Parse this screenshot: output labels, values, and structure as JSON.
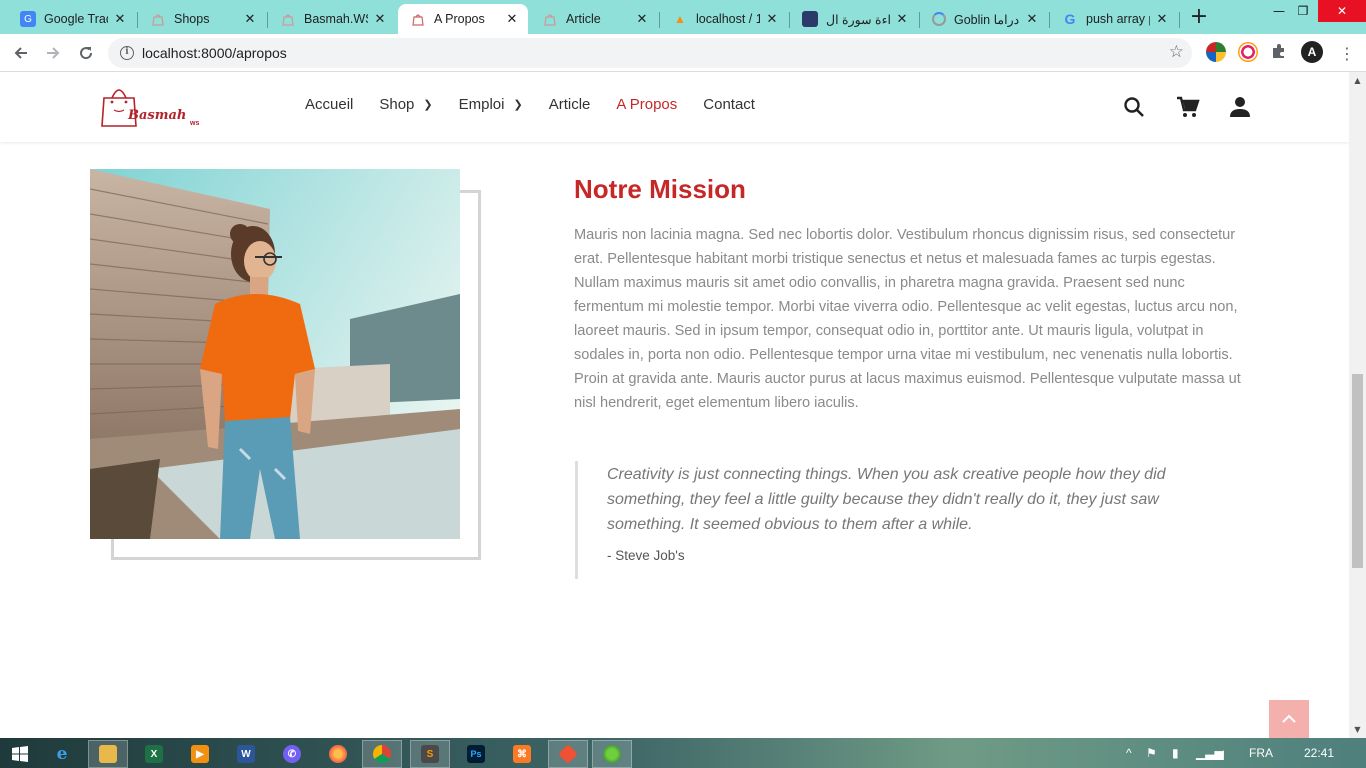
{
  "browser": {
    "tabs": [
      {
        "title": "Google Trad",
        "favicon": "google-translate-icon",
        "active": false
      },
      {
        "title": "Shops",
        "favicon": "basmah-bag-icon",
        "active": false
      },
      {
        "title": "Basmah.WS",
        "favicon": "basmah-bag-icon",
        "active": false
      },
      {
        "title": "A Propos",
        "favicon": "basmah-bag-icon",
        "active": true
      },
      {
        "title": "Article",
        "favicon": "basmah-bag-icon",
        "active": false
      },
      {
        "title": "localhost / 1",
        "favicon": "phpmyadmin-icon",
        "active": false
      },
      {
        "title": "قراءة سورة ال",
        "favicon": "quran-icon",
        "active": false
      },
      {
        "title": "Goblin دراما",
        "favicon": "loading-icon",
        "active": false
      },
      {
        "title": "push array p",
        "favicon": "google-icon",
        "active": false
      }
    ],
    "new_tab_symbol": "+",
    "url": "localhost:8000/apropos",
    "colors": {
      "tabbar": "#8ee0d8",
      "accent": "#c62828"
    }
  },
  "site": {
    "logo": {
      "text": "Basmah",
      "suffix": "ws"
    },
    "nav": [
      {
        "label": "Accueil",
        "has_submenu": false,
        "active": false
      },
      {
        "label": "Shop",
        "has_submenu": true,
        "active": false
      },
      {
        "label": "Emploi",
        "has_submenu": true,
        "active": false
      },
      {
        "label": "Article",
        "has_submenu": false,
        "active": false
      },
      {
        "label": "A Propos",
        "has_submenu": false,
        "active": true
      },
      {
        "label": "Contact",
        "has_submenu": false,
        "active": false
      }
    ],
    "header_icons": [
      "search-icon",
      "cart-icon",
      "user-icon"
    ]
  },
  "about": {
    "title": "Notre Mission",
    "paragraph": "Mauris non lacinia magna. Sed nec lobortis dolor. Vestibulum rhoncus dignissim risus, sed consectetur erat. Pellentesque habitant morbi tristique senectus et netus et malesuada fames ac turpis egestas. Nullam maximus mauris sit amet odio convallis, in pharetra magna gravida. Praesent sed nunc fermentum mi molestie tempor. Morbi vitae viverra odio. Pellentesque ac velit egestas, luctus arcu non, laoreet mauris. Sed in ipsum tempor, consequat odio in, porttitor ante. Ut mauris ligula, volutpat in sodales in, porta non odio. Pellentesque tempor urna vitae mi vestibulum, nec venenatis nulla lobortis. Proin at gravida ante. Mauris auctor purus at lacus maximus euismod. Pellentesque vulputate massa ut nisl hendrerit, eget elementum libero iaculis.",
    "quote": "Creativity is just connecting things. When you ask creative people how they did something, they feel a little guilty because they didn't really do it, they just saw something. It seemed obvious to them after a while.",
    "quote_author": "- Steve Job's",
    "back_to_top_icon": "chevron-up-icon"
  },
  "taskbar": {
    "apps": [
      "windows-start-icon",
      "internet-explorer-icon",
      "file-explorer-icon",
      "excel-icon",
      "media-player-icon",
      "word-icon",
      "viber-icon",
      "firefox-icon",
      "chrome-icon",
      "sublime-text-icon",
      "photoshop-icon",
      "xampp-icon",
      "git-icon",
      "map-app-icon"
    ],
    "language": "FRA",
    "time": "22:41"
  }
}
